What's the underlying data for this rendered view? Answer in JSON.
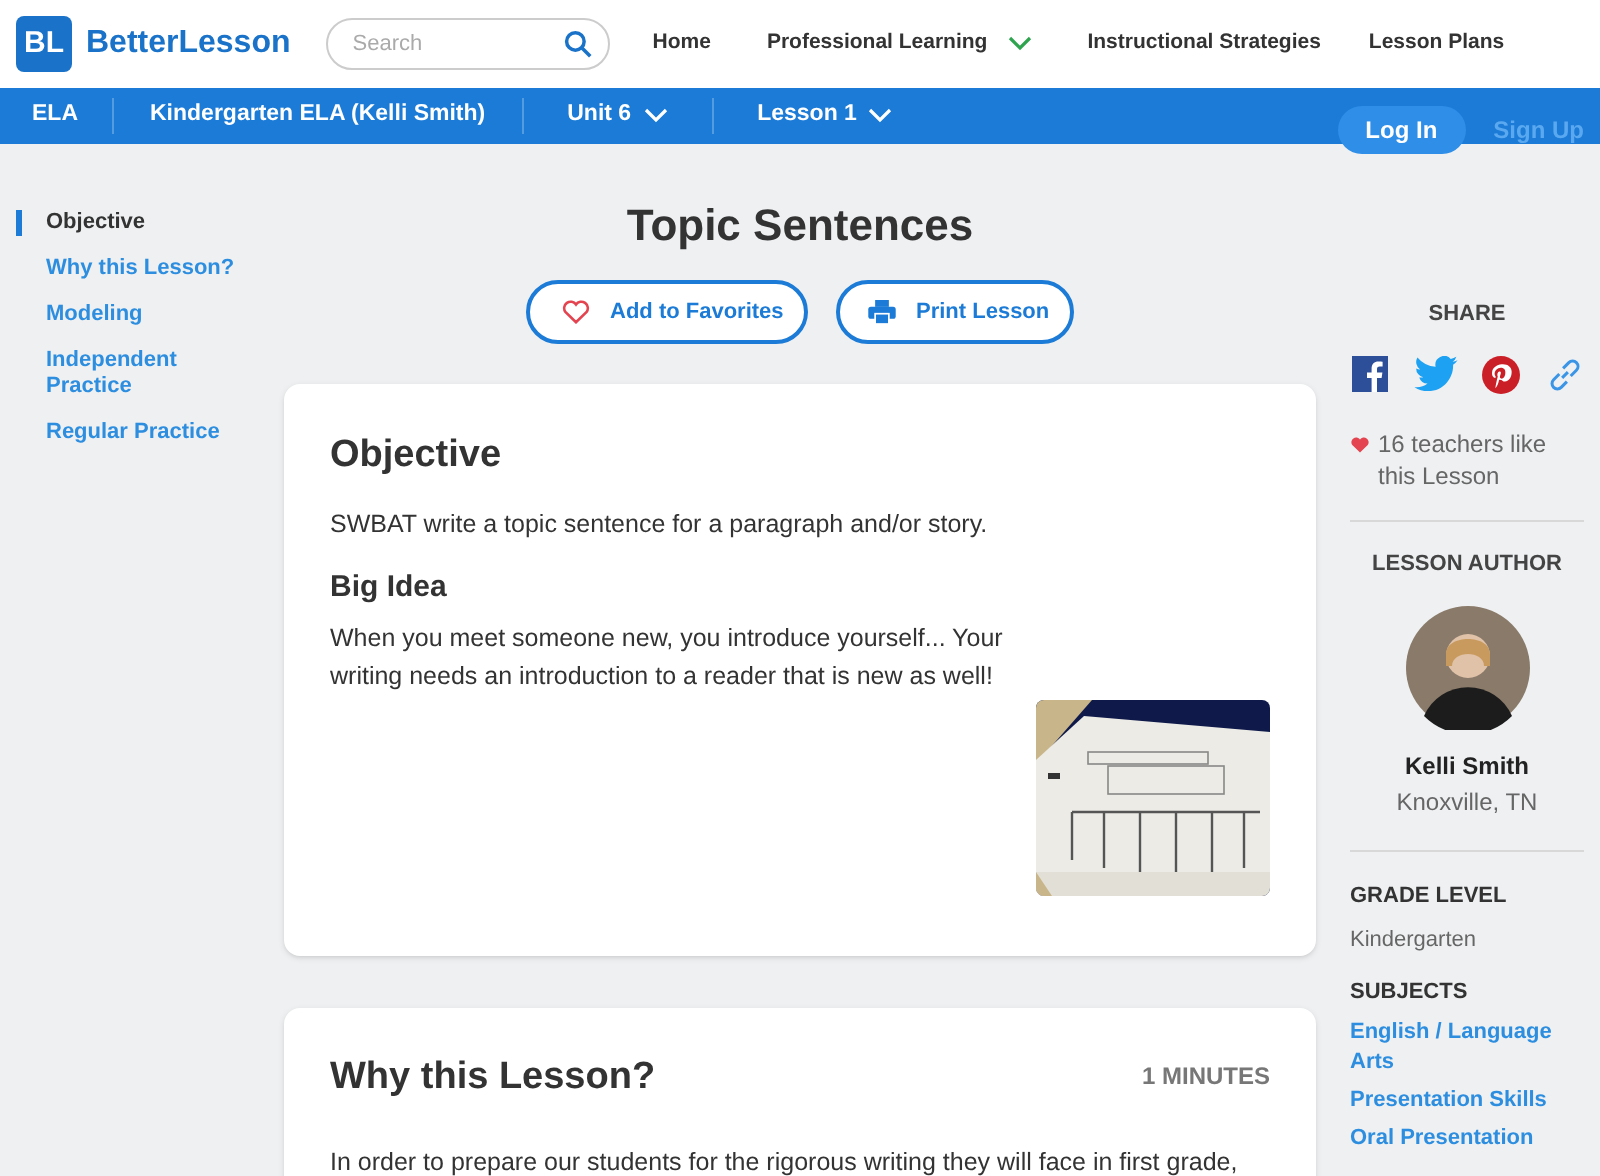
{
  "header": {
    "logo_mark": "BL",
    "logo_text": "BetterLesson",
    "search": {
      "placeholder": "Search"
    },
    "nav": [
      {
        "label": "Home",
        "has_menu": false
      },
      {
        "label": "Professional Learning",
        "has_menu": true
      },
      {
        "label": "Instructional Strategies",
        "has_menu": false
      },
      {
        "label": "Lesson Plans",
        "has_menu": false
      }
    ]
  },
  "breadcrumb": [
    {
      "label": "ELA",
      "has_menu": false
    },
    {
      "label": "Kindergarten ELA (Kelli Smith)",
      "has_menu": false
    },
    {
      "label": "Unit 6",
      "has_menu": true
    },
    {
      "label": "Lesson 1",
      "has_menu": true
    }
  ],
  "account": {
    "login": "Log In",
    "signup": "Sign Up"
  },
  "sidebar": {
    "items": [
      {
        "label": "Objective",
        "selected": true
      },
      {
        "label": "Why this Lesson?",
        "selected": false
      },
      {
        "label": "Modeling",
        "selected": false
      },
      {
        "label": "Independent Practice",
        "selected": false
      },
      {
        "label": "Regular Practice",
        "selected": false
      }
    ]
  },
  "lesson": {
    "title": "Topic Sentences",
    "actions": [
      {
        "kind": "favorite",
        "label": "Add to Favorites"
      },
      {
        "kind": "print",
        "label": "Print Lesson"
      }
    ],
    "sections": [
      {
        "title": "Objective",
        "text": "SWBAT write a topic sentence for a paragraph and/or story.",
        "subheading": "Big Idea",
        "subtext": "When you meet someone new, you introduce yourself... Your writing needs an introduction to a reader that is new as well!"
      },
      {
        "title": "Why this Lesson?",
        "duration": "1 MINUTES",
        "text": "In order to prepare our students for the rigorous writing they will face in first grade,"
      }
    ]
  },
  "aside": {
    "share_heading": "SHARE",
    "share": [
      {
        "kind": "facebook"
      },
      {
        "kind": "twitter"
      },
      {
        "kind": "pinterest"
      },
      {
        "kind": "link"
      }
    ],
    "likes": "16 teachers like this Lesson",
    "author_heading": "LESSON AUTHOR",
    "author_name": "Kelli Smith",
    "author_location": "Knoxville, TN",
    "grade_heading": "GRADE LEVEL",
    "grade": "Kindergarten",
    "subjects_heading": "SUBJECTS",
    "subjects": [
      "English / Language Arts",
      "Presentation Skills",
      "Oral Presentation"
    ]
  }
}
